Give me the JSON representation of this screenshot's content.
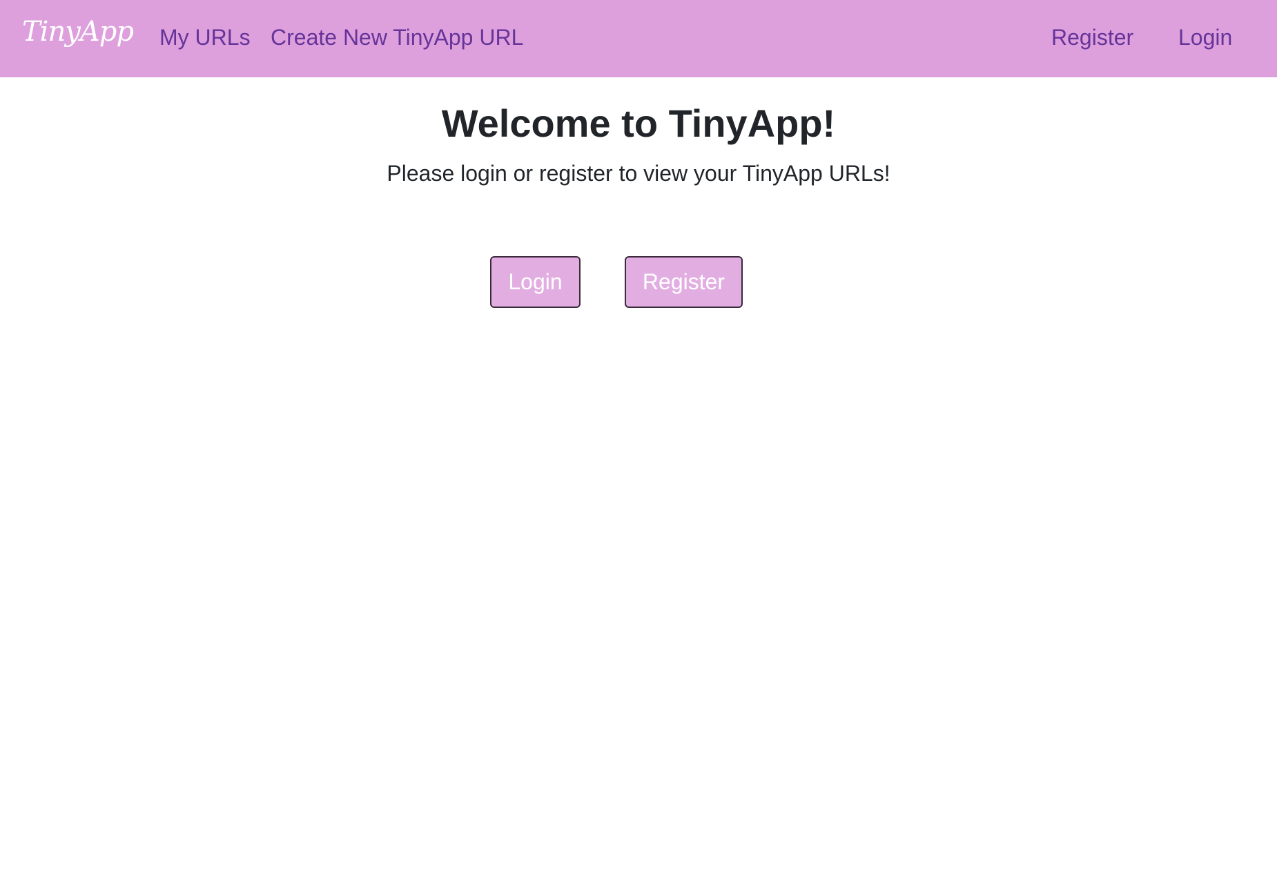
{
  "navbar": {
    "brand": "TinyApp",
    "links": {
      "my_urls": "My URLs",
      "create_new": "Create New TinyApp URL",
      "register": "Register",
      "login": "Login"
    }
  },
  "main": {
    "title": "Welcome to TinyApp!",
    "subtitle": "Please login or register to view your TinyApp URLs!",
    "buttons": {
      "login": "Login",
      "register": "Register"
    }
  },
  "colors": {
    "navbar_bg": "#dda0dd",
    "nav_link": "#663399",
    "button_bg": "#e2aee2",
    "text": "#212529"
  }
}
